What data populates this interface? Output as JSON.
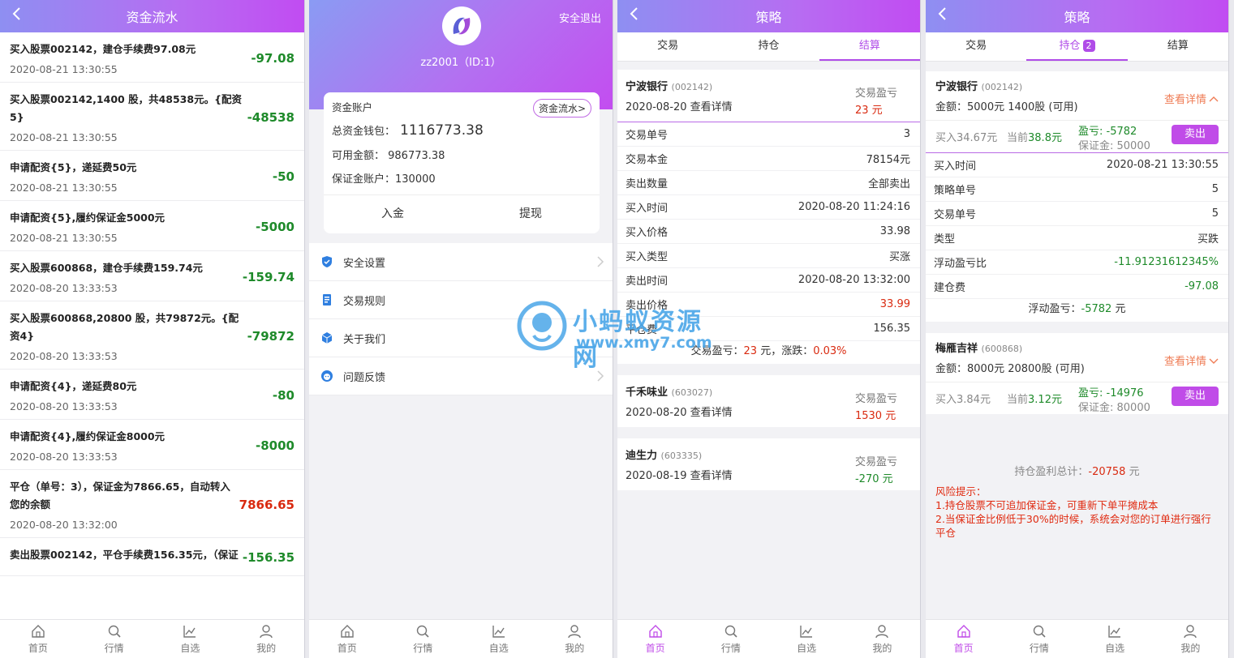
{
  "panel1": {
    "title": "资金流水",
    "items": [
      {
        "desc": "买入股票002142，建仓手续费97.08元",
        "time": "2020-08-21 13:30:55",
        "amount": "-97.08",
        "type": "neg"
      },
      {
        "desc": "买入股票002142,1400 股，共48538元。{配资5}",
        "time": "2020-08-21 13:30:55",
        "amount": "-48538",
        "type": "neg"
      },
      {
        "desc": "申请配资{5}，递延费50元",
        "time": "2020-08-21 13:30:55",
        "amount": "-50",
        "type": "neg"
      },
      {
        "desc": "申请配资{5},履约保证金5000元",
        "time": "2020-08-21 13:30:55",
        "amount": "-5000",
        "type": "neg"
      },
      {
        "desc": "买入股票600868，建仓手续费159.74元",
        "time": "2020-08-20 13:33:53",
        "amount": "-159.74",
        "type": "neg"
      },
      {
        "desc": "买入股票600868,20800 股，共79872元。{配资4}",
        "time": "2020-08-20 13:33:53",
        "amount": "-79872",
        "type": "neg"
      },
      {
        "desc": "申请配资{4}，递延费80元",
        "time": "2020-08-20 13:33:53",
        "amount": "-80",
        "type": "neg"
      },
      {
        "desc": "申请配资{4},履约保证金8000元",
        "time": "2020-08-20 13:33:53",
        "amount": "-8000",
        "type": "neg"
      },
      {
        "desc": "平仓（单号：3），保证金为7866.65，自动转入您的余额",
        "time": "2020-08-20 13:32:00",
        "amount": "7866.65",
        "type": "pos"
      },
      {
        "desc": "卖出股票002142，平仓手续费156.35元，（保证",
        "time": "",
        "amount": "-156.35",
        "type": "neg"
      }
    ]
  },
  "panel2": {
    "logout": "安全退出",
    "username": "zz2001（ID:1）",
    "account_title": "资金账户",
    "flow_button": "资金流水>",
    "total_label": "总资金钱包：",
    "total_value": "1116773.38",
    "available": "可用金额：  986773.38",
    "margin": "保证金账户：130000",
    "deposit": "入金",
    "withdraw": "提现",
    "menu": [
      "安全设置",
      "交易规则",
      "关于我们",
      "问题反馈"
    ]
  },
  "panel3": {
    "title": "策略",
    "tabs": [
      "交易",
      "持仓",
      "结算"
    ],
    "profit_label": "交易盈亏",
    "cards": [
      {
        "name": "宁波银行",
        "code": "(002142)",
        "date": "2020-08-20 查看详情",
        "profit": "23 元",
        "neg": false,
        "details": [
          {
            "k": "交易单号",
            "v": "3",
            "c": ""
          },
          {
            "k": "交易本金",
            "v": "78154元",
            "c": ""
          },
          {
            "k": "卖出数量",
            "v": "全部卖出",
            "c": ""
          },
          {
            "k": "买入时间",
            "v": "2020-08-20 11:24:16",
            "c": ""
          },
          {
            "k": "买入价格",
            "v": "33.98",
            "c": ""
          },
          {
            "k": "买入类型",
            "v": "买涨",
            "c": ""
          },
          {
            "k": "卖出时间",
            "v": "2020-08-20 13:32:00",
            "c": ""
          },
          {
            "k": "卖出价格",
            "v": "33.99",
            "c": "red"
          },
          {
            "k": "平仓费",
            "v": "156.35",
            "c": ""
          }
        ],
        "sum_label": "交易盈亏：",
        "sum_value": "23",
        "sum_unit": "元，涨跌：",
        "sum_pct": "0.03%"
      },
      {
        "name": "千禾味业",
        "code": "(603027)",
        "date": "2020-08-20 查看详情",
        "profit": "1530 元",
        "neg": false
      },
      {
        "name": "迪生力",
        "code": "(603335)",
        "date": "2020-08-19 查看详情",
        "profit": "-270 元",
        "neg": true
      }
    ]
  },
  "panel4": {
    "title": "策略",
    "tabs": [
      "交易",
      "持仓",
      "结算"
    ],
    "badge": "2",
    "cards": [
      {
        "name": "宁波银行",
        "code": "(002142)",
        "amount": "金额：5000元  1400股 (可用)",
        "detail_link": "查看详情",
        "buy": "买入34.67元",
        "now_label": "当前",
        "now": "38.8元",
        "pl": "盈亏: -5782",
        "margin": "保证金: 50000",
        "sell": "卖出",
        "details": [
          {
            "k": "买入时间",
            "v": "2020-08-21 13:30:55",
            "c": ""
          },
          {
            "k": "策略单号",
            "v": "5",
            "c": ""
          },
          {
            "k": "交易单号",
            "v": "5",
            "c": ""
          },
          {
            "k": "类型",
            "v": "买跌",
            "c": ""
          },
          {
            "k": "浮动盈亏比",
            "v": "-11.91231612345%",
            "c": "green"
          },
          {
            "k": "建仓费",
            "v": "-97.08",
            "c": "green"
          }
        ],
        "float_label": "浮动盈亏：",
        "float_value": "-5782",
        "float_unit": "元"
      },
      {
        "name": "梅雁吉祥",
        "code": "(600868)",
        "amount": "金额：8000元  20800股 (可用)",
        "detail_link": "查看详情",
        "buy": "买入3.84元",
        "now_label": "当前",
        "now": "3.12元",
        "pl": "盈亏: -14976",
        "margin": "保证金: 80000",
        "sell": "卖出"
      }
    ],
    "total_label": "持仓盈利总计：",
    "total_value": "-20758",
    "total_unit": "元",
    "risk": [
      "风险提示：",
      "1.持仓股票不可追加保证金，可重新下单平摊成本",
      "2.当保证金比例低于30%的时候，系统会对您的订单进行强行平仓"
    ]
  },
  "tabbar": [
    "首页",
    "行情",
    "自选",
    "我的"
  ],
  "watermark": {
    "line1": "小蚂蚁资源网",
    "line2": "www.xmy7.com"
  },
  "colors": {
    "accent": "#b04ce8",
    "profit": "#d92a10",
    "loss": "#1e8a2a",
    "link": "#ef7c55"
  }
}
